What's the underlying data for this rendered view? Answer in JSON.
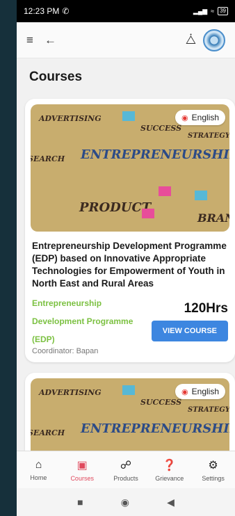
{
  "status_bar": {
    "time": "12:23 PM",
    "battery": "39"
  },
  "app_bar": {
    "menu_icon": "menu-icon",
    "back_icon": "back-arrow-icon",
    "share_icon": "share-icon",
    "logo_icon": "logo-emblem"
  },
  "page": {
    "title": "Courses"
  },
  "courses": [
    {
      "language": "English",
      "image_words": [
        "ADVERTISING",
        "SUCCESS",
        "STRATEGY",
        "SEARCH",
        "ENTREPRENEURSHIP",
        "PRODUCT",
        "BRAND"
      ],
      "title": "Entrepreneurship Development Programme (EDP) based on Innovative Appropriate Technologies for Empowerment of Youth in North East and Rural Areas",
      "programme": "Entrepreneurship Development Programme (EDP)",
      "coordinator": "Coordinator: Bapan",
      "hours": "120Hrs",
      "button": "VIEW COURSE"
    },
    {
      "language": "English",
      "image_words": [
        "ADVERTISING",
        "SUCCESS",
        "STRATEGY",
        "SEARCH",
        "ENTREPRENEURSHIP"
      ]
    }
  ],
  "bottom_nav": [
    {
      "label": "Home",
      "icon": "home-icon",
      "active": false
    },
    {
      "label": "Courses",
      "icon": "book-icon",
      "active": true
    },
    {
      "label": "Products",
      "icon": "cart-icon",
      "active": false
    },
    {
      "label": "Grievance",
      "icon": "help-icon",
      "active": false
    },
    {
      "label": "Settings",
      "icon": "gear-icon",
      "active": false
    }
  ],
  "colors": {
    "accent": "#e0495d",
    "button": "#3d86e0",
    "programme_text": "#7cc142"
  }
}
